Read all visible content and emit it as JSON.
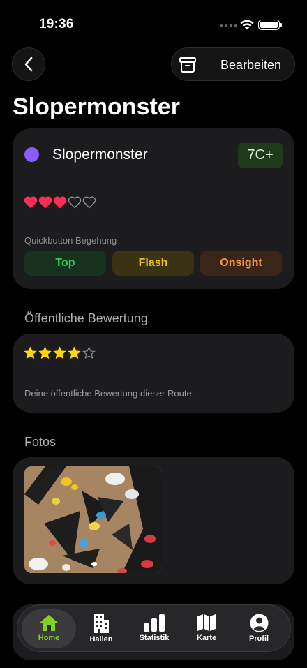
{
  "status": {
    "time": "19:36"
  },
  "nav": {
    "edit_label": "Bearbeiten"
  },
  "page": {
    "title": "Slopermonster"
  },
  "route": {
    "name": "Slopermonster",
    "grade": "7C+",
    "color": "#8b5cf6",
    "hearts_filled": 3,
    "hearts_total": 5
  },
  "quick": {
    "label": "Quickbutton Begehung",
    "buttons": [
      "Top",
      "Flash",
      "Onsight"
    ]
  },
  "rating": {
    "section_title": "Öffentliche Bewertung",
    "stars_filled": 4,
    "stars_total": 5,
    "description": "Deine öffentliche Bewertung dieser Route."
  },
  "photos": {
    "section_title": "Fotos",
    "count": 1
  },
  "tabs": [
    {
      "label": "Home",
      "icon": "home-icon",
      "active": true
    },
    {
      "label": "Hallen",
      "icon": "building-icon",
      "active": false
    },
    {
      "label": "Statistik",
      "icon": "bar-chart-icon",
      "active": false
    },
    {
      "label": "Karte",
      "icon": "map-icon",
      "active": false
    },
    {
      "label": "Profil",
      "icon": "profile-icon",
      "active": false
    }
  ],
  "colors": {
    "accent_green": "#7ed321",
    "top": "#34c759",
    "flash": "#e6c21a",
    "onsight": "#f29845",
    "heart": "#ff2d55",
    "star": "#ffd60a"
  }
}
